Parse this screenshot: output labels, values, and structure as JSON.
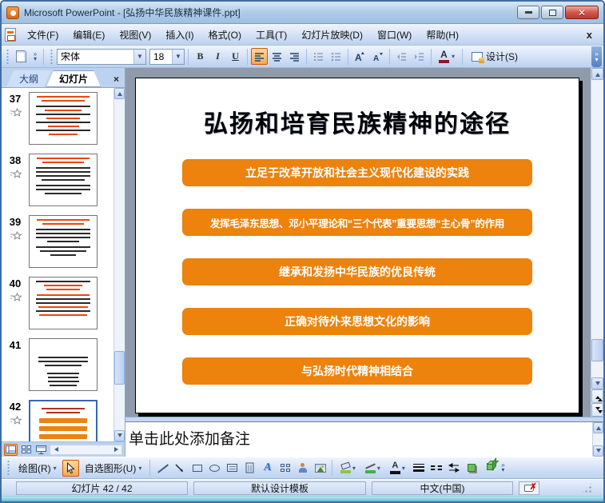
{
  "window": {
    "title": "Microsoft PowerPoint - [弘扬中华民族精神课件.ppt]"
  },
  "menu_bar": {
    "items": [
      "文件(F)",
      "编辑(E)",
      "视图(V)",
      "插入(I)",
      "格式(O)",
      "工具(T)",
      "幻灯片放映(D)",
      "窗口(W)",
      "帮助(H)"
    ],
    "close_label": "x"
  },
  "format_toolbar": {
    "font_name": "宋体",
    "font_size": "18",
    "bold_label": "B",
    "italic_label": "I",
    "underline_label": "U",
    "design_label": "设计(S)"
  },
  "slides_pane": {
    "outline_tab": "大纲",
    "slides_tab": "幻灯片",
    "close_label": "×",
    "thumbnails": [
      {
        "number": "37"
      },
      {
        "number": "38"
      },
      {
        "number": "39"
      },
      {
        "number": "40"
      },
      {
        "number": "41"
      },
      {
        "number": "42"
      }
    ]
  },
  "slide": {
    "title": "弘扬和培育民族精神的途径",
    "accent_color": "#ED820D",
    "bars": [
      "立足于改革开放和社会主义现代化建设的实践",
      "发挥毛泽东思想、邓小平理论和“三个代表”重要思想“主心骨”的作用",
      "继承和发扬中华民族的优良传统",
      "正确对待外来思想文化的影响",
      "与弘扬时代精神相结合"
    ]
  },
  "notes": {
    "placeholder": "单击此处添加备注"
  },
  "drawing_toolbar": {
    "draw_label": "绘图(R)",
    "autoshapes_label": "自选图形(U)"
  },
  "status_bar": {
    "slide_indicator": "幻灯片 42 / 42",
    "design_template": "默认设计模板",
    "language": "中文(中国)"
  }
}
